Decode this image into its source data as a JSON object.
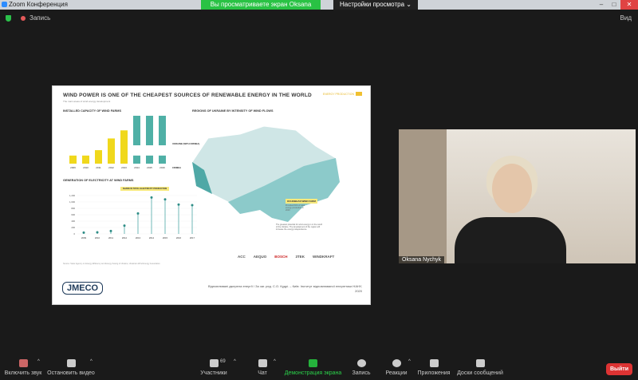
{
  "window": {
    "title": "Zoom Конференция",
    "share_banner": "Вы просматриваете экран Oksana Nychyk",
    "view_options": "Настройки просмотра ⌄"
  },
  "topbar": {
    "record": "Запись",
    "view": "Вид"
  },
  "slide": {
    "title": "WIND POWER IS ONE OF THE CHEAPEST SOURCES OF RENEWABLE ENERGY IN THE WORLD",
    "subtitle": "The main areas of wind energy development",
    "tag": "ENERGY PRODUCTION",
    "chart1_title": "INSTALLED CAPACITY OF WIND FARMS",
    "chart2_title": "GENERATION OF ELECTRICITY AT WIND FARMS",
    "map_title": "REGIONS OF UKRAINE BY INTENSITY OF WIND FLOWS",
    "share_label": "SHARE IN TOTAL ELECTRICITY PRODUCTION",
    "label_ukraine": "UKRAINE (WITH CRIMEA)",
    "label_ukraine2": "UKRAINE",
    "label_crimea": "CRIMEA",
    "wind_farm_label": "ОСНОВНАЯ WIND FARM",
    "wind_note": "Provided 84% of wind energy production in 2016",
    "potential_note": "The greatest potential for wind energy is in the south of the Ukraine. The development of the region will increase the energy independence.",
    "footnote": "Source: State Agency on Energy Efficiency and Energy Saving of Ukraine; Ukrainian Wind Energy Association",
    "logos": [
      "ACC",
      "AEQUO",
      "BOSCH",
      "3TEK",
      "WINDKRAFT"
    ],
    "logo": "JMECO",
    "citation": "Відновлювані джерела енергії / За заг. ред. С.О. Кудрі. – Київ: Інститут відновлюваної енергетики НАНУ, 2020"
  },
  "chart_data": [
    {
      "type": "bar",
      "title": "INSTALLED CAPACITY OF WIND FARMS",
      "categories": [
        "2009",
        "2010",
        "2011",
        "2012",
        "2013",
        "2014",
        "2015",
        "2016"
      ],
      "series": [
        {
          "name": "Ukraine",
          "values": [
            90,
            90,
            150,
            280,
            370,
            null,
            null,
            null
          ]
        },
        {
          "name": "Ukraine (mainland)",
          "values": [
            null,
            null,
            null,
            null,
            null,
            500,
            510,
            520
          ]
        },
        {
          "name": "Crimea",
          "values": [
            null,
            null,
            null,
            null,
            null,
            90,
            90,
            90
          ]
        }
      ]
    },
    {
      "type": "line",
      "title": "GENERATION OF ELECTRICITY AT WIND FARMS",
      "x": [
        "2009",
        "2010",
        "2011",
        "2012",
        "2013",
        "2014",
        "2015",
        "2016",
        "2017"
      ],
      "values": [
        40,
        50,
        90,
        260,
        640,
        1140,
        1080,
        920,
        900
      ],
      "ylim": [
        0,
        1200
      ],
      "yticks": [
        "0",
        "200",
        "400",
        "600",
        "800",
        "1,000",
        "1,200"
      ]
    }
  ],
  "video": {
    "name": "Oksana Nychyk"
  },
  "toolbar": {
    "mute": "Включить звук",
    "video": "Остановить видео",
    "participants": "Участники",
    "participants_count": "69",
    "chat": "Чат",
    "share": "Демонстрация экрана",
    "record": "Запись",
    "reactions": "Реакции",
    "apps": "Приложения",
    "whiteboards": "Доски сообщений",
    "leave": "Выйти"
  }
}
